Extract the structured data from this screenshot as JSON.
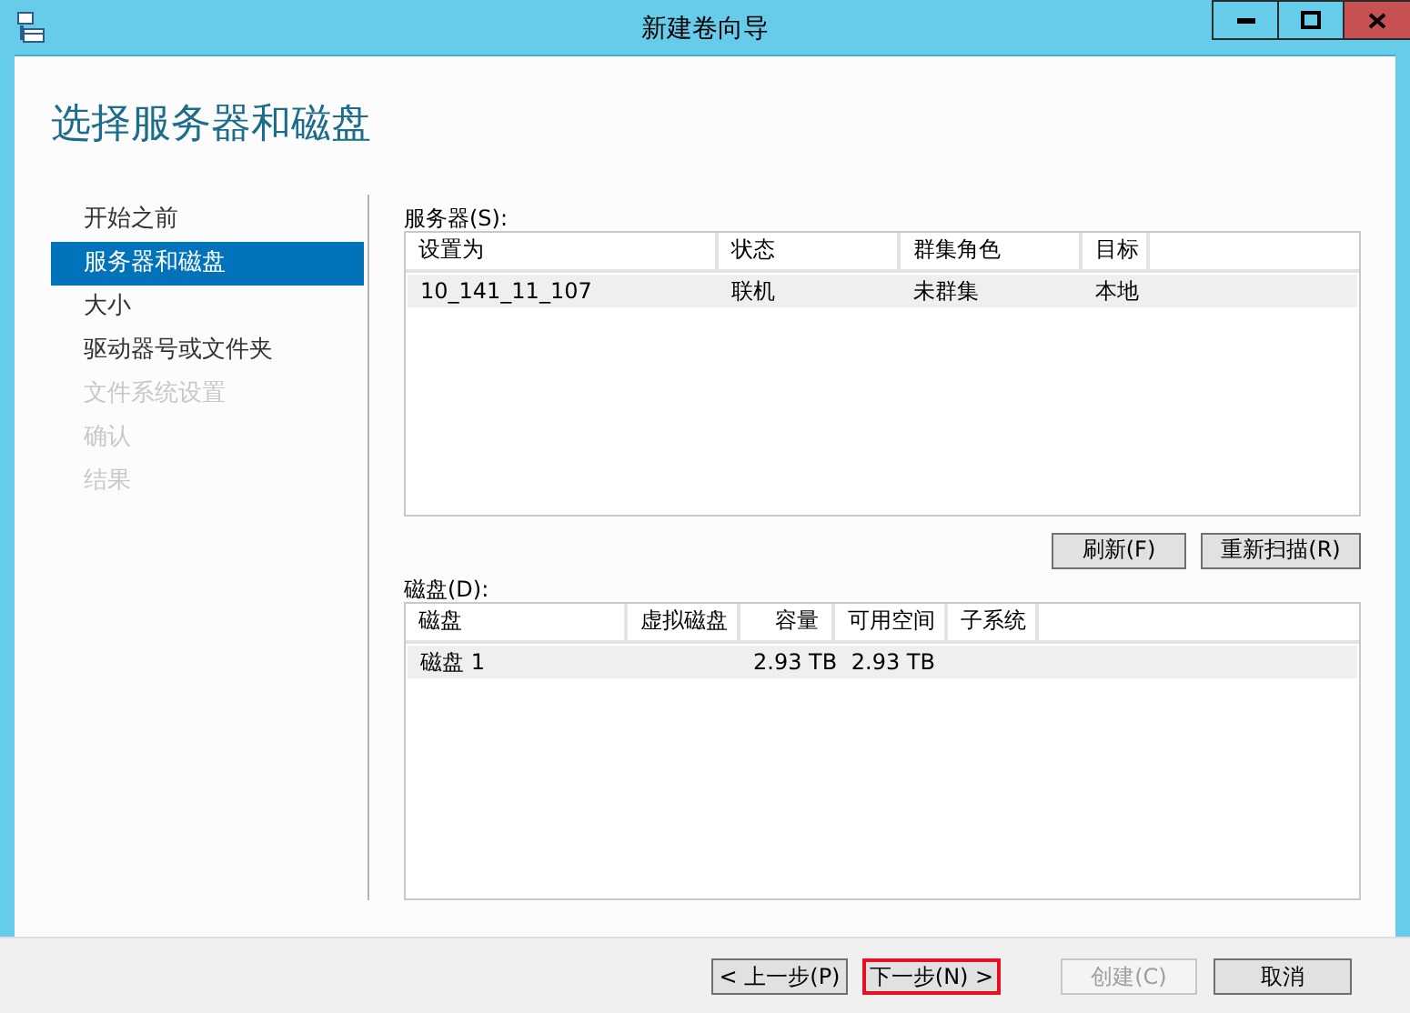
{
  "window": {
    "title": "新建卷向导"
  },
  "page_title": "选择服务器和磁盘",
  "sidebar": {
    "items": [
      {
        "label": "开始之前",
        "selected": false,
        "disabled": false
      },
      {
        "label": "服务器和磁盘",
        "selected": true,
        "disabled": false
      },
      {
        "label": "大小",
        "selected": false,
        "disabled": false
      },
      {
        "label": "驱动器号或文件夹",
        "selected": false,
        "disabled": false
      },
      {
        "label": "文件系统设置",
        "selected": false,
        "disabled": true
      },
      {
        "label": "确认",
        "selected": false,
        "disabled": true
      },
      {
        "label": "结果",
        "selected": false,
        "disabled": true
      }
    ]
  },
  "servers": {
    "label": "服务器(S):",
    "columns": [
      "设置为",
      "状态",
      "群集角色",
      "目标"
    ],
    "rows": [
      {
        "cells": [
          "10_141_11_107",
          "联机",
          "未群集",
          "本地"
        ],
        "selected": true
      }
    ],
    "buttons": [
      {
        "label": "刷新(F)",
        "disabled": false
      },
      {
        "label": "重新扫描(R)",
        "disabled": false
      }
    ]
  },
  "disks": {
    "label": "磁盘(D):",
    "columns": [
      "磁盘",
      "虚拟磁盘",
      "容量",
      "可用空间",
      "子系统"
    ],
    "rows": [
      {
        "cells": [
          "磁盘 1",
          "",
          "2.93 TB",
          "2.93 TB",
          ""
        ],
        "selected": true
      }
    ]
  },
  "footer_buttons": [
    {
      "label": "< 上一步(P)",
      "disabled": false,
      "focused": false
    },
    {
      "label": "下一步(N) >",
      "disabled": false,
      "focused": true
    },
    {
      "label": "创建(C)",
      "disabled": true,
      "focused": false
    },
    {
      "label": "取消",
      "disabled": false,
      "focused": false
    }
  ]
}
